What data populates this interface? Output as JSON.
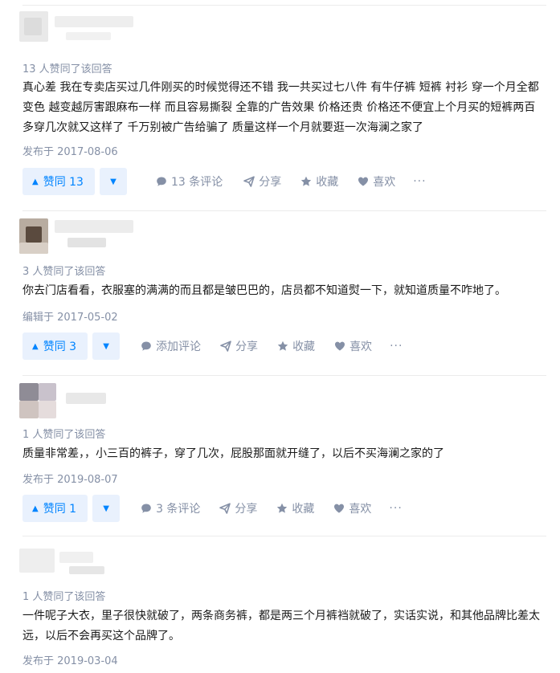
{
  "answers": [
    {
      "votes_text": "13 人赞同了该回答",
      "content": "真心差 我在专卖店买过几件刚买的时候觉得还不错 我一共买过七八件 有牛仔裤 短裤 衬衫 穿一个月全都变色 越变越厉害跟麻布一样 而且容易撕裂 全靠的广告效果 价格还贵 价格还不便宜上个月买的短裤两百多穿几次就又这样了 千万别被广告给骗了 质量这样一个月就要逛一次海澜之家了",
      "date_text": "发布于 2017-08-06",
      "vote_label": "赞同 13",
      "comment_label": "13 条评论",
      "share_label": "分享",
      "collect_label": "收藏",
      "like_label": "喜欢",
      "more_label": "···"
    },
    {
      "votes_text": "3 人赞同了该回答",
      "content": "你去门店看看，衣服塞的满满的而且都是皱巴巴的，店员都不知道熨一下，就知道质量不咋地了。",
      "date_text": "编辑于 2017-05-02",
      "vote_label": "赞同 3",
      "comment_label": "添加评论",
      "share_label": "分享",
      "collect_label": "收藏",
      "like_label": "喜欢",
      "more_label": "···"
    },
    {
      "votes_text": "1 人赞同了该回答",
      "content": "质量非常差，，小三百的裤子，穿了几次，屁股那面就开缝了，以后不买海澜之家的了",
      "date_text": "发布于 2019-08-07",
      "vote_label": "赞同 1",
      "comment_label": "3 条评论",
      "share_label": "分享",
      "collect_label": "收藏",
      "like_label": "喜欢",
      "more_label": "···"
    },
    {
      "votes_text": "1 人赞同了该回答",
      "content": "一件呢子大衣，里子很快就破了，两条商务裤，都是两三个月裤裆就破了，实话实说，和其他品牌比差太远，以后不会再买这个品牌了。",
      "date_text": "发布于 2019-03-04"
    }
  ],
  "icons": {
    "vote_up": "triangle-up-icon",
    "vote_down": "triangle-down-icon",
    "comment": "comment-bubble-icon",
    "share": "paper-plane-icon",
    "collect": "star-icon",
    "like": "heart-icon"
  },
  "colors": {
    "accent": "#0084ff",
    "vote_bg": "#e9f1fd",
    "meta_text": "#8590a6",
    "body_text": "#1a1a1a",
    "divider": "#ebebeb"
  }
}
